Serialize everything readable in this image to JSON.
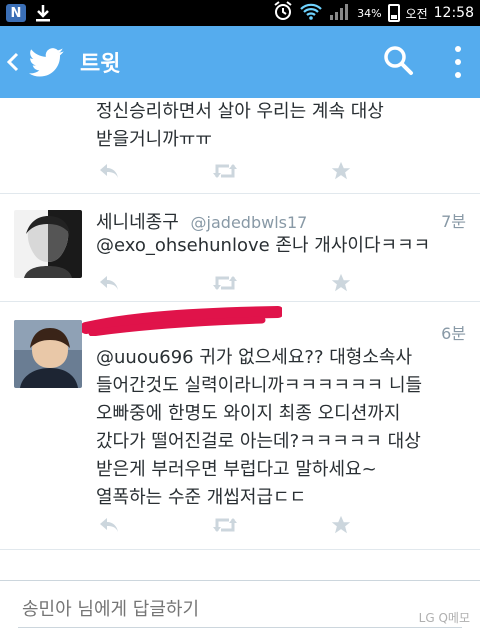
{
  "status_bar": {
    "battery": "34%",
    "time_prefix": "오전",
    "time": "12:58"
  },
  "app_bar": {
    "title": "트윗"
  },
  "tweets": [
    {
      "text_lines": [
        "정신승리하면서 살아 우리는 계속 대상",
        "받을거니까ㅠㅠ"
      ]
    },
    {
      "name": "세니네종구",
      "handle": "@jadedbwls17",
      "time": "7분",
      "text": "@exo_ohsehunlove 존나 개사이다ㅋㅋㅋ"
    },
    {
      "name": "",
      "handle": "",
      "time": "6분",
      "text_lines": [
        "@uuou696 귀가 없으세요?? 대형소속사",
        "들어간것도 실력이라니까ㅋㅋㅋㅋㅋㅋ 니들",
        "오빠중에 한명도 와이지 최종 오디션까지",
        "갔다가 떨어진걸로 아는데?ㅋㅋㅋㅋㅋ 대상",
        "받은게 부러우면 부럽다고 말하세요~",
        "열폭하는 수준 개씹저급ㄷㄷ"
      ]
    }
  ],
  "reply": {
    "placeholder": "송민아 님에게 답글하기"
  },
  "watermark": "LG Q메모",
  "icons": {
    "notification": "N",
    "download": "download-icon",
    "alarm": "alarm-icon",
    "wifi": "wifi-icon",
    "signal": "signal-icon",
    "battery": "battery-icon",
    "back": "chevron-left-icon",
    "brand": "twitter-bird-icon",
    "search": "search-icon",
    "overflow": "overflow-menu-icon",
    "reply": "reply-icon",
    "retweet": "retweet-icon",
    "favorite": "star-icon"
  },
  "colors": {
    "brand_blue": "#55acee",
    "icon_gray": "#ccd6dd",
    "text": "#292f33",
    "muted": "#8899a6",
    "redaction": "#e0134a"
  }
}
